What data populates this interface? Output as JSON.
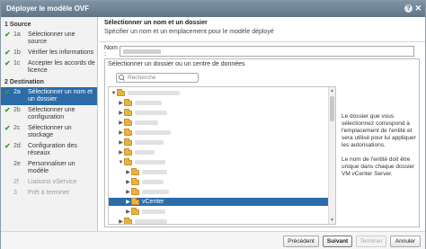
{
  "window": {
    "title": "Déployer le modèle OVF",
    "help_glyph": "?",
    "close_glyph": "✕"
  },
  "steps": {
    "section_source": "1  Source",
    "section_destination": "2  Destination",
    "check_glyph": "✔",
    "items": [
      {
        "num": "1a",
        "label": "Sélectionner une source",
        "done": true
      },
      {
        "num": "1b",
        "label": "Vérifier les informations",
        "done": true
      },
      {
        "num": "1c",
        "label": "Accepter les accords de licence",
        "done": true
      },
      {
        "num": "2a",
        "label": "Sélectionner un nom et un dossier",
        "done": true,
        "active": true
      },
      {
        "num": "2b",
        "label": "Sélectionner une configuration",
        "done": true
      },
      {
        "num": "2c",
        "label": "Sélectionner un stockage",
        "done": true
      },
      {
        "num": "2d",
        "label": "Configuration des réseaux",
        "done": true
      },
      {
        "num": "2e",
        "label": "Personnaliser un modèle",
        "done": false
      },
      {
        "num": "2f",
        "label": "Liaisons vService",
        "done": false,
        "disabled": true
      },
      {
        "num": "3",
        "label": "Prêt à terminer",
        "done": false,
        "disabled": true
      }
    ]
  },
  "main": {
    "title": "Sélectionner un nom et un dossier",
    "subtitle": "Spécifier un nom et un emplacement pour le modèle déployé",
    "name_label": "Nom :",
    "name_value": ""
  },
  "folder_panel": {
    "title": "Sélectionner un dossier ou un centre de données",
    "search_placeholder": "Recherche",
    "tree": {
      "expand_glyph": "▶",
      "collapse_glyph": "▼",
      "selected_label": "vCenter"
    }
  },
  "info": {
    "paragraph1": "Le dossier que vous sélectionnez correspond à l'emplacement de l'entité et sera utilisé pour lui appliquer les autorisations.",
    "paragraph2": "Le nom de l'entité doit être unique dans chaque dossier VM vCenter Server."
  },
  "footer": {
    "previous_label": "Précédent",
    "next_label": "Suivant",
    "finish_label": "Terminer",
    "cancel_label": "Annuler"
  },
  "colors": {
    "accent": "#2b6ca9",
    "titlebar": "#6a8096",
    "check": "#3c9a3c",
    "folder": "#e8b341"
  }
}
